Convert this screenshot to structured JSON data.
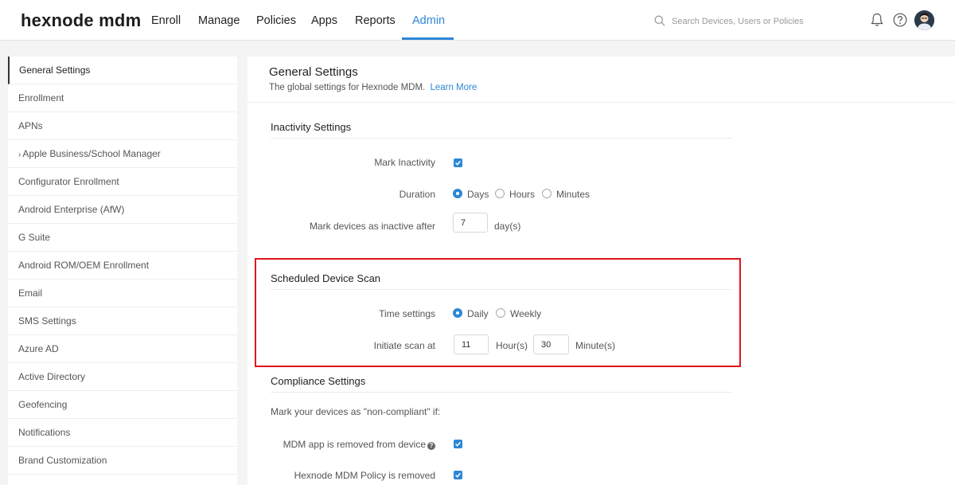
{
  "app": {
    "logo": "hexnode mdm"
  },
  "nav": {
    "items": [
      {
        "label": "Enroll"
      },
      {
        "label": "Manage"
      },
      {
        "label": "Policies"
      },
      {
        "label": "Apps"
      },
      {
        "label": "Reports"
      },
      {
        "label": "Admin"
      }
    ],
    "active": "Admin"
  },
  "search": {
    "placeholder": "Search Devices, Users or Policies"
  },
  "sidebar": {
    "items": [
      {
        "label": "General Settings"
      },
      {
        "label": "Enrollment"
      },
      {
        "label": "APNs"
      },
      {
        "label": "Apple Business/School Manager"
      },
      {
        "label": "Configurator Enrollment"
      },
      {
        "label": "Android Enterprise (AfW)"
      },
      {
        "label": "G Suite"
      },
      {
        "label": "Android ROM/OEM Enrollment"
      },
      {
        "label": "Email"
      },
      {
        "label": "SMS Settings"
      },
      {
        "label": "Azure AD"
      },
      {
        "label": "Active Directory"
      },
      {
        "label": "Geofencing"
      },
      {
        "label": "Notifications"
      },
      {
        "label": "Brand Customization"
      }
    ]
  },
  "main": {
    "title": "General Settings",
    "subtitle": "The global settings for Hexnode MDM.",
    "learn_more": "Learn More",
    "inactivity": {
      "title": "Inactivity Settings",
      "mark_inactivity_label": "Mark Inactivity",
      "duration_label": "Duration",
      "duration_options": [
        "Days",
        "Hours",
        "Minutes"
      ],
      "duration_selected": "Days",
      "inactive_after_label": "Mark devices as inactive after",
      "inactive_after_value": "7",
      "inactive_after_unit": "day(s)"
    },
    "scan": {
      "title": "Scheduled Device Scan",
      "time_settings_label": "Time settings",
      "time_options": [
        "Daily",
        "Weekly"
      ],
      "time_selected": "Daily",
      "initiate_label": "Initiate scan at",
      "hour_value": "11",
      "hour_unit": "Hour(s)",
      "minute_value": "30",
      "minute_unit": "Minute(s)"
    },
    "compliance": {
      "title": "Compliance Settings",
      "intro": "Mark your devices as \"non-compliant\" if:",
      "app_removed_label": "MDM app is removed from device",
      "policy_removed_label": "Hexnode MDM Policy is removed"
    }
  },
  "colors": {
    "accent": "#2d87d7",
    "highlight": "#e0161e"
  }
}
